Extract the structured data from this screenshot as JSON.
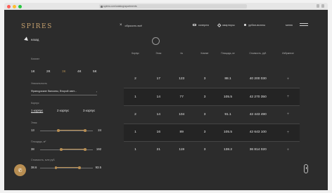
{
  "browser": {
    "url": "spires.com/catalog/apartments",
    "dot_colors": [
      "#ff5f57",
      "#febc2e",
      "#28c840"
    ]
  },
  "header": {
    "logo": "SPIRES",
    "reset_label": "сбросить всё",
    "nav": [
      {
        "label": "галерея",
        "icon": "gallery-icon"
      },
      {
        "label": "квартиры",
        "icon": "apartments-icon"
      },
      {
        "label": "урбан-виллы",
        "icon": "villa-icon"
      }
    ],
    "menu_label": "меню"
  },
  "sidebar": {
    "back_label": "назад",
    "rooms": {
      "label": "Комнат",
      "options": [
        "1К",
        "2К",
        "3К",
        "4К",
        "5К"
      ],
      "active": "3К"
    },
    "uniqueness": {
      "label": "Уникальность",
      "value": "Французские балконы, Второй свет..."
    },
    "korpus": {
      "label": "Корпус",
      "options": [
        "1 корпус",
        "2 корпус",
        "3 корпус"
      ]
    },
    "floor": {
      "label": "Этаж",
      "min": "13",
      "max": "24",
      "low": 0.35,
      "high": 0.85
    },
    "area": {
      "label": "Площадь, м²",
      "min": "38",
      "max": "192",
      "low": 0.4,
      "high": 0.85
    },
    "price": {
      "label": "Стоимость, млн руб.",
      "min": "38.6",
      "max": "93.5",
      "low": 0.3,
      "high": 0.75
    }
  },
  "table": {
    "headers": [
      "Корпус",
      "Этаж",
      "№",
      "Комнат",
      "Площадь, м²",
      "Стоимость, руб.",
      "Избранное"
    ],
    "rows": [
      {
        "korpus": "2",
        "floor": "17",
        "num": "123",
        "rooms": "3",
        "area": "88.1",
        "cost": "40 200 030",
        "fav": "+"
      },
      {
        "korpus": "1",
        "floor": "14",
        "num": "77",
        "rooms": "3",
        "area": "105.5",
        "cost": "42 270 350",
        "fav": "+"
      },
      {
        "korpus": "2",
        "floor": "14",
        "num": "104",
        "rooms": "3",
        "area": "91.1",
        "cost": "42 443 490",
        "fav": "+"
      },
      {
        "korpus": "1",
        "floor": "16",
        "num": "89",
        "rooms": "3",
        "area": "105.5",
        "cost": "42 643 100",
        "fav": "+"
      },
      {
        "korpus": "1",
        "floor": "21",
        "num": "119",
        "rooms": "3",
        "area": "138.2",
        "cost": "36 814 020",
        "fav": "+"
      }
    ]
  },
  "colors": {
    "accent": "#b88e52",
    "background": "#2c2c2c"
  }
}
